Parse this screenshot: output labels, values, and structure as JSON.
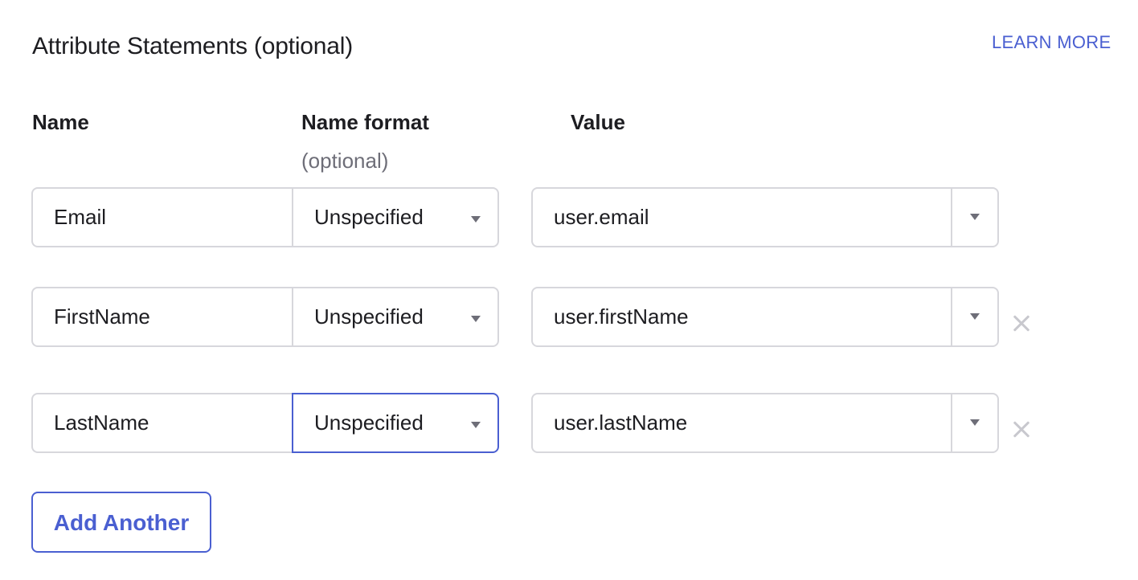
{
  "section": {
    "title": "Attribute Statements (optional)",
    "learn_more": "LEARN MORE"
  },
  "headers": {
    "name": "Name",
    "name_format": "Name format",
    "name_format_hint": "(optional)",
    "value": "Value"
  },
  "rows": [
    {
      "name": "Email",
      "name_format": "Unspecified",
      "value": "user.email",
      "removable": false,
      "format_focused": false
    },
    {
      "name": "FirstName",
      "name_format": "Unspecified",
      "value": "user.firstName",
      "removable": true,
      "format_focused": false
    },
    {
      "name": "LastName",
      "name_format": "Unspecified",
      "value": "user.lastName",
      "removable": true,
      "format_focused": true
    }
  ],
  "add_button_label": "Add Another",
  "icons": {
    "format_dropdown": "chevron-down-icon",
    "value_dropdown": "chevron-down-icon",
    "remove_row": "close-icon"
  },
  "colors": {
    "accent": "#4a5fd1",
    "border": "#d7d7dc",
    "text": "#1d1d21",
    "muted": "#6e6e78",
    "remove_icon": "#c8c8ce"
  }
}
